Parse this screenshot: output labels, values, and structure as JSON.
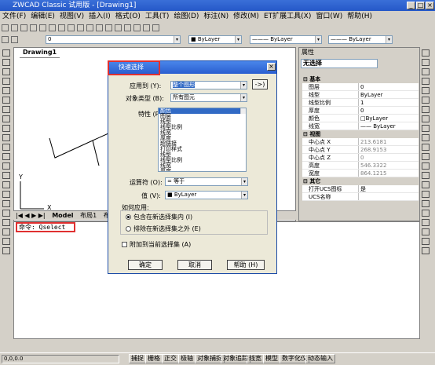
{
  "window": {
    "title": "ZWCAD Classic 试用版 - [Drawing1]"
  },
  "menu": [
    "文件(F)",
    "编辑(E)",
    "视图(V)",
    "插入(I)",
    "格式(O)",
    "工具(T)",
    "绘图(D)",
    "标注(N)",
    "修改(M)",
    "ET扩展工具(X)",
    "窗口(W)",
    "帮助(H)"
  ],
  "toolbar2": {
    "layer_value": "0",
    "color_value": "ByLayer",
    "linetype_value": "ByLayer",
    "lineweight_value": "ByLayer"
  },
  "drawing": {
    "tab_label": "Drawing1",
    "layout_tabs": [
      "Model",
      "布局1",
      "布局2"
    ]
  },
  "axes": {
    "x": "X",
    "y": "Y"
  },
  "command": {
    "text": "命令: Qselect"
  },
  "properties": {
    "header": "属性",
    "selection": "无选择",
    "categories": [
      {
        "name": "基本",
        "rows": [
          {
            "k": "图层",
            "v": "0"
          },
          {
            "k": "线型",
            "v": "ByLayer"
          },
          {
            "k": "线型比例",
            "v": "1"
          },
          {
            "k": "厚度",
            "v": "0"
          },
          {
            "k": "颜色",
            "v": "□ByLayer"
          },
          {
            "k": "线宽",
            "v": "—— ByLayer"
          }
        ]
      },
      {
        "name": "视图",
        "rows": [
          {
            "k": "中心点 X",
            "v": "213.6181"
          },
          {
            "k": "中心点 Y",
            "v": "268.9153"
          },
          {
            "k": "中心点 Z",
            "v": "0"
          },
          {
            "k": "高度",
            "v": "546.3322"
          },
          {
            "k": "宽度",
            "v": "864.1215"
          }
        ]
      },
      {
        "name": "其它",
        "rows": [
          {
            "k": "打开UCS图标",
            "v": "是"
          },
          {
            "k": "UCS名称",
            "v": ""
          }
        ]
      }
    ]
  },
  "dialog": {
    "title": "快速选择",
    "apply_to_label": "应用到 (Y):",
    "apply_to_value": "整个图形",
    "object_type_label": "对象类型 (B):",
    "object_type_value": "所有图元",
    "properties_label": "特性 (P):",
    "properties_list": [
      "颜色",
      "图层",
      "线型",
      "线型比例",
      "线宽",
      "厚度",
      "超链接",
      "打印样式",
      "线型",
      "线型比例",
      "线宽",
      "厚度"
    ],
    "operator_label": "运算符 (O):",
    "operator_value": "= 等于",
    "value_label": "值 (V):",
    "value_value": "■ ByLayer",
    "how_to_apply_label": "如何应用:",
    "include_option": "包含在新选择集内 (I)",
    "exclude_option": "排除在新选择集之外 (E)",
    "append_label": "附加到当前选择集 (A)",
    "ok": "确定",
    "cancel": "取消",
    "help": "帮助 (H)",
    "select_objects_btn": "->)"
  },
  "status": {
    "coords": "0,0,0.0",
    "buttons": [
      "捕捉",
      "栅格",
      "正交",
      "极轴",
      "对象捕捉",
      "对象追踪",
      "线宽",
      "模型",
      "数字化仪",
      "动态输入"
    ]
  }
}
